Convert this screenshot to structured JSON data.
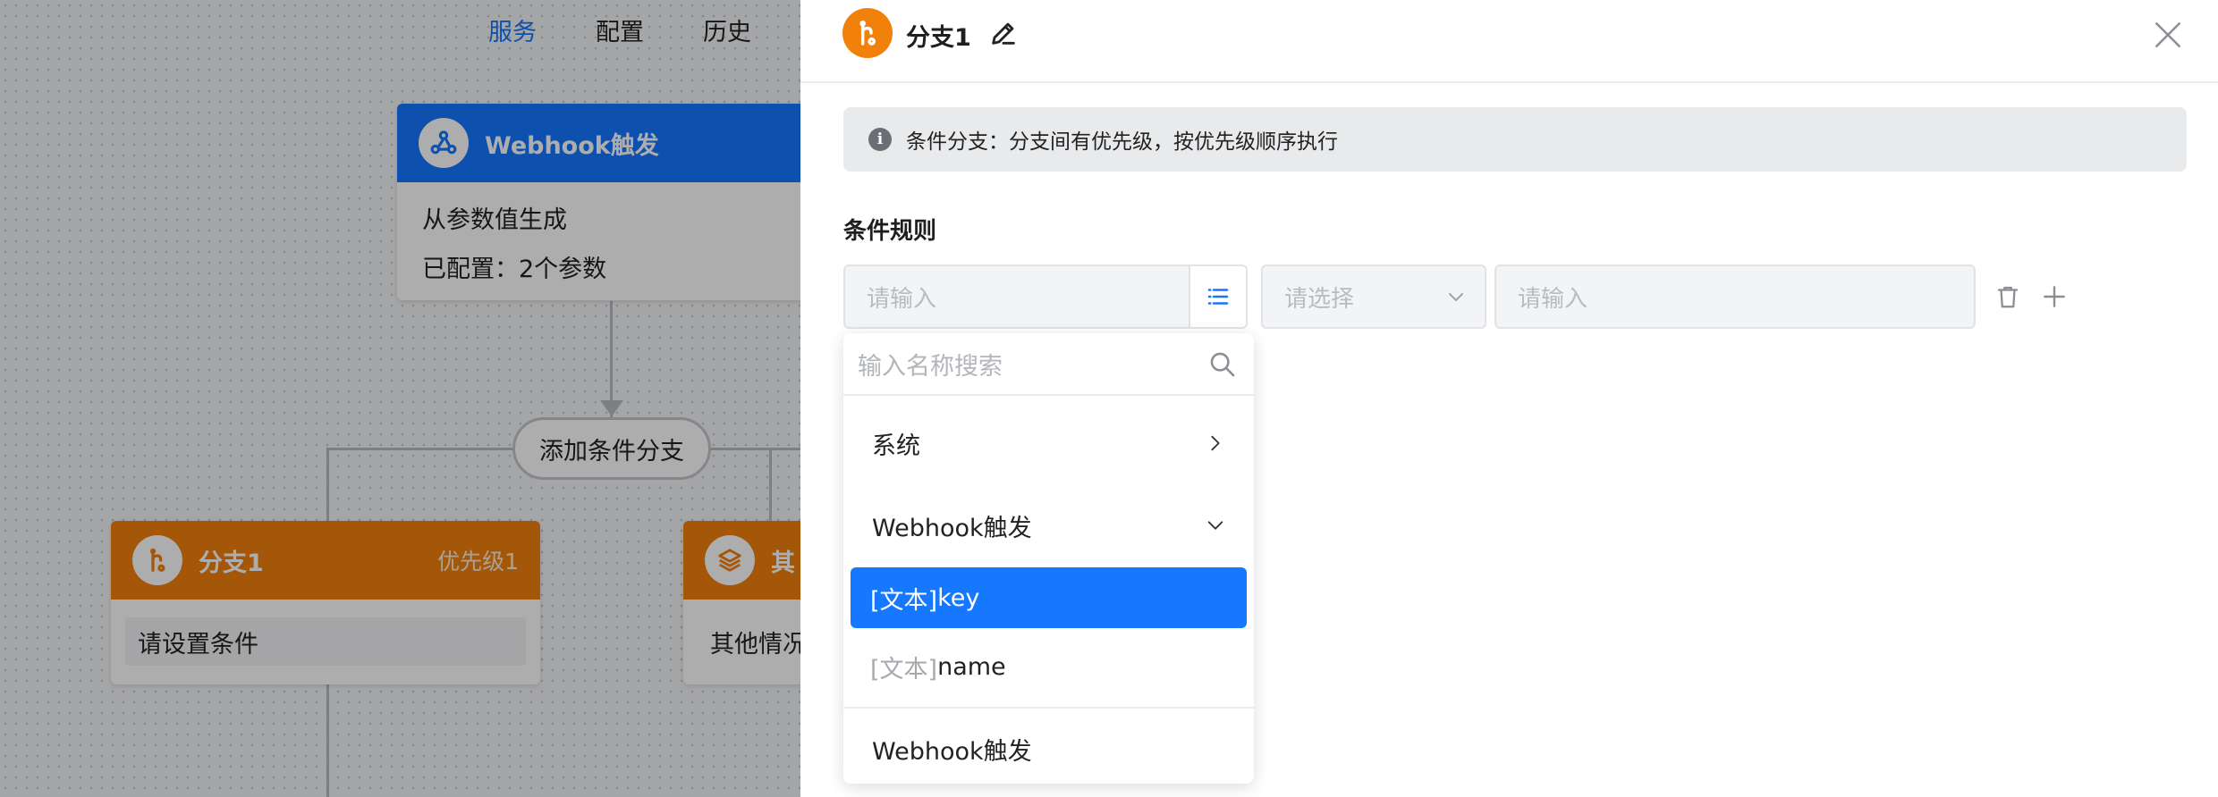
{
  "nav": {
    "tabs": [
      "服务",
      "配置",
      "历史"
    ],
    "active_index": 0
  },
  "flow": {
    "trigger_node": {
      "title": "Webhook触发",
      "line1": "从参数值生成",
      "line2": "已配置：2个参数"
    },
    "add_branch_label": "添加条件分支",
    "branch_node": {
      "title": "分支1",
      "priority": "优先级1",
      "condition_placeholder": "请设置条件"
    },
    "other_node": {
      "title": "其",
      "body": "其他情况"
    }
  },
  "panel": {
    "title": "分支1",
    "info_text": "条件分支：分支间有优先级，按优先级顺序执行",
    "rules_title": "条件规则",
    "field_placeholder": "请输入",
    "operator_placeholder": "请选择",
    "value_placeholder": "请输入",
    "dropdown": {
      "search_placeholder": "输入名称搜索",
      "groups": [
        {
          "label": "系统",
          "state": "collapsed"
        },
        {
          "label": "Webhook触发",
          "state": "expanded"
        }
      ],
      "options": [
        {
          "tag": "[文本]",
          "name": "key",
          "selected": true
        },
        {
          "tag": "[文本]",
          "name": "name",
          "selected": false
        }
      ],
      "footer_item": "Webhook触发"
    }
  },
  "colors": {
    "accent": "#1677ff",
    "branch": "#f2810c"
  }
}
